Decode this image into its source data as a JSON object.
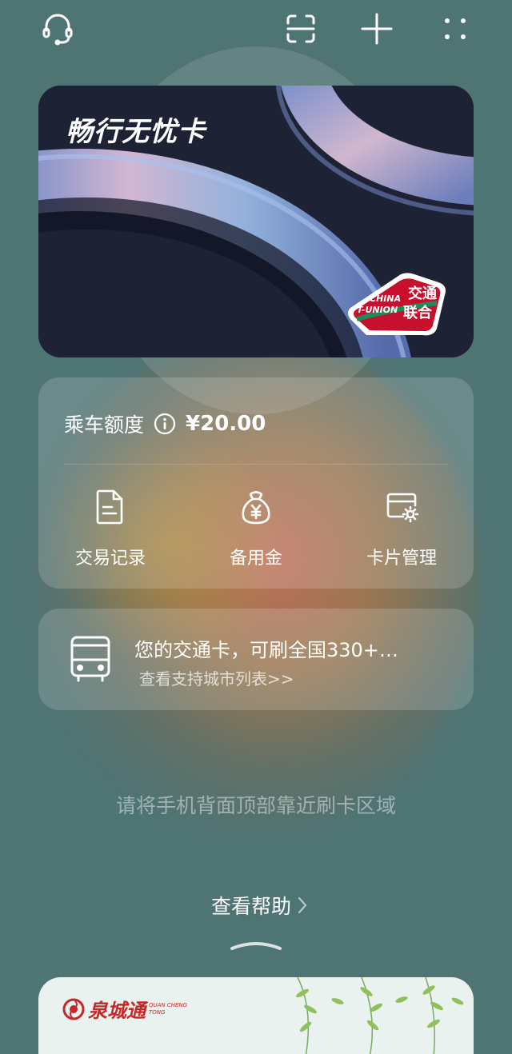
{
  "topbar": {
    "icons": [
      "headset-icon",
      "scan-icon",
      "plus-icon",
      "more-icon"
    ]
  },
  "card": {
    "title": "畅行无忧卡",
    "logo_cn": "交通联合",
    "logo_cn_line1": "交通",
    "logo_cn_line2": "联合",
    "logo_en_line1": "CHINA",
    "logo_en_line2": "T-UNION",
    "logo_color": "#c8102e"
  },
  "balance": {
    "label": "乘车额度",
    "value": "¥20.00"
  },
  "actions": [
    {
      "label": "交易记录",
      "icon": "document-icon"
    },
    {
      "label": "备用金",
      "icon": "money-bag-icon"
    },
    {
      "label": "卡片管理",
      "icon": "card-settings-icon"
    }
  ],
  "info": {
    "title": "您的交通卡，可刷全国330+…",
    "link": "查看支持城市列表>>"
  },
  "hint": "请将手机背面顶部靠近刷卡区域",
  "help": "查看帮助",
  "next_card": {
    "brand": "泉城通",
    "brand_en_line1": "QUAN CHENG",
    "brand_en_line2": "TONG",
    "brand_color": "#c62828"
  },
  "colors": {
    "background": "#4f7474",
    "card_background": "#1d2234"
  }
}
